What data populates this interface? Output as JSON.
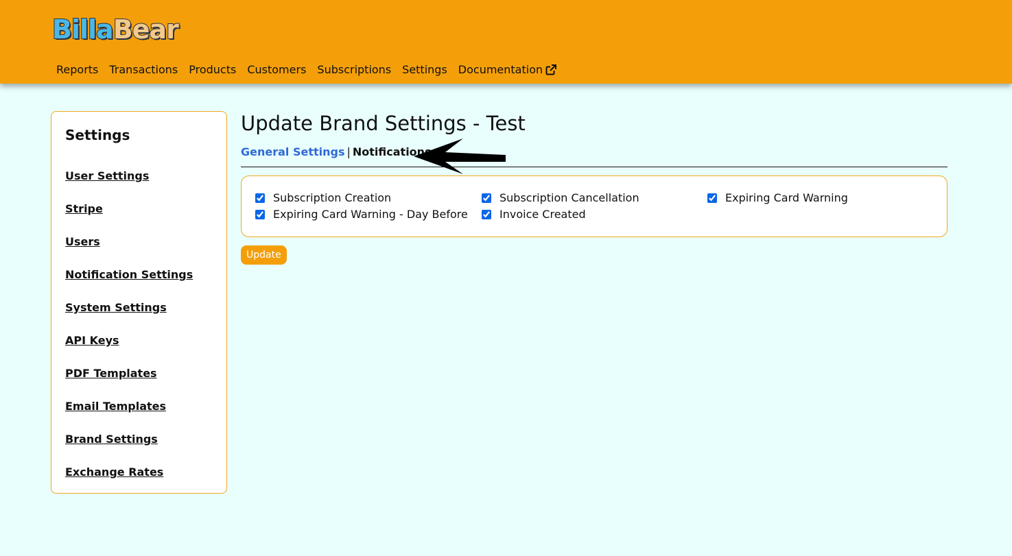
{
  "logo": {
    "part1": "Billa",
    "part2": "Bear"
  },
  "nav": {
    "items": [
      "Reports",
      "Transactions",
      "Products",
      "Customers",
      "Subscriptions",
      "Settings",
      "Documentation"
    ],
    "documentation_icon": "external-link-icon"
  },
  "sidebar": {
    "title": "Settings",
    "items": [
      "User Settings",
      "Stripe",
      "Users",
      "Notification Settings",
      "System Settings",
      "API Keys",
      "PDF Templates",
      "Email Templates",
      "Brand Settings",
      "Exchange Rates"
    ]
  },
  "main": {
    "title": "Update Brand Settings - Test",
    "tabs": {
      "general": "General Settings",
      "separator": "|",
      "notifications": "Notifications"
    },
    "checkboxes": [
      {
        "label": "Subscription Creation",
        "checked": true
      },
      {
        "label": "Subscription Cancellation",
        "checked": true
      },
      {
        "label": "Expiring Card Warning",
        "checked": true
      },
      {
        "label": "Expiring Card Warning - Day Before",
        "checked": true
      },
      {
        "label": "Invoice Created",
        "checked": true
      }
    ],
    "update_button": "Update"
  },
  "colors": {
    "header": "#f49f0a",
    "background": "#e9fffe",
    "link": "#2f6ad6",
    "border": "#f0a81e"
  }
}
